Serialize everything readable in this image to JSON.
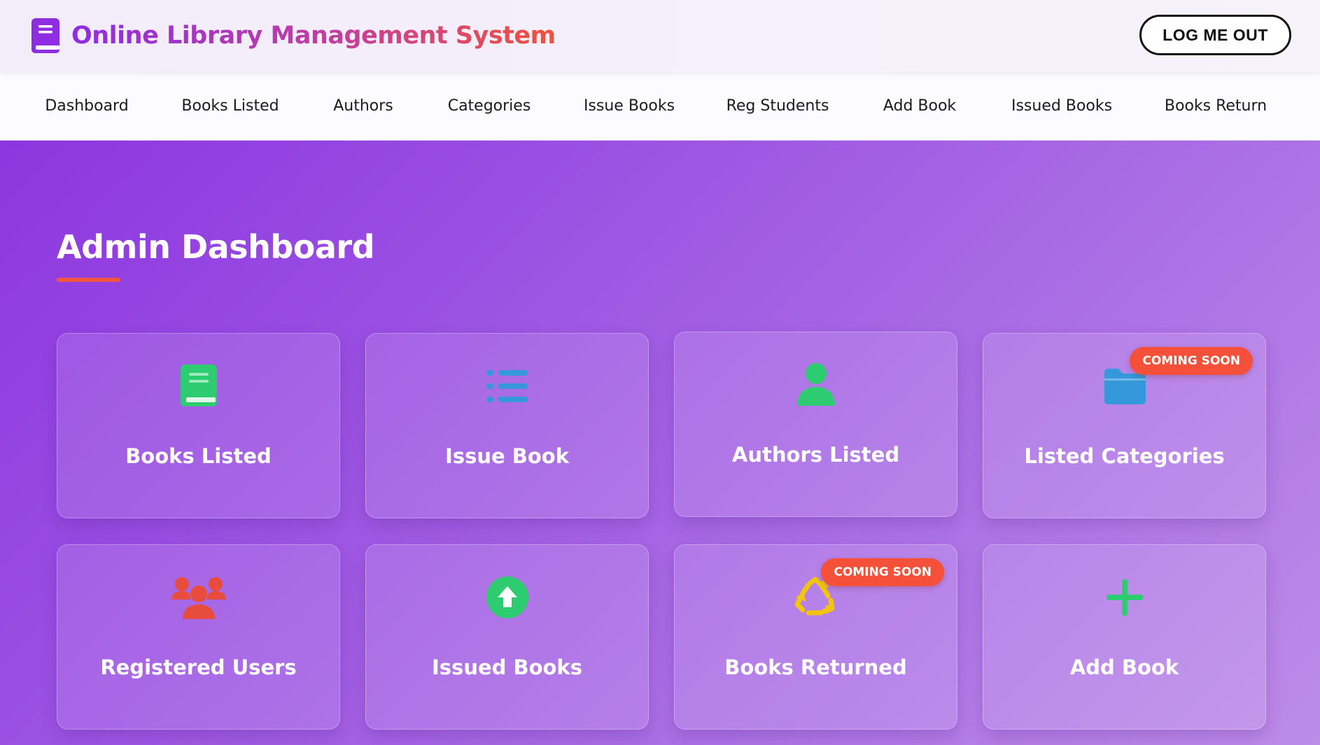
{
  "header": {
    "brand_title": "Online Library Management System",
    "logout_label": "LOG ME OUT"
  },
  "nav": {
    "items": [
      {
        "label": "Dashboard"
      },
      {
        "label": "Books Listed"
      },
      {
        "label": "Authors"
      },
      {
        "label": "Categories"
      },
      {
        "label": "Issue Books"
      },
      {
        "label": "Reg Students"
      },
      {
        "label": "Add Book"
      },
      {
        "label": "Issued Books"
      },
      {
        "label": "Books Return"
      }
    ]
  },
  "main": {
    "title": "Admin Dashboard",
    "cards": [
      {
        "label": "Books Listed",
        "icon": "book-icon",
        "color": "#2ecc71"
      },
      {
        "label": "Issue Book",
        "icon": "list-icon",
        "color": "#3498db"
      },
      {
        "label": "Authors Listed",
        "icon": "user-icon",
        "color": "#2ecc71"
      },
      {
        "label": "Listed Categories",
        "icon": "folder-icon",
        "color": "#3498db",
        "badge": "COMING SOON"
      },
      {
        "label": "Registered Users",
        "icon": "users-icon",
        "color": "#e74c3c"
      },
      {
        "label": "Issued Books",
        "icon": "upload-circle-icon",
        "color": "#2ecc71"
      },
      {
        "label": "Books Returned",
        "icon": "recycle-icon",
        "color": "#f1c40f",
        "badge": "COMING SOON"
      },
      {
        "label": "Add Book",
        "icon": "plus-icon",
        "color": "#2ecc71"
      }
    ]
  },
  "colors": {
    "accent_red": "#f25541",
    "gradient_start": "#8e2de2",
    "gradient_end": "#f2513c"
  }
}
